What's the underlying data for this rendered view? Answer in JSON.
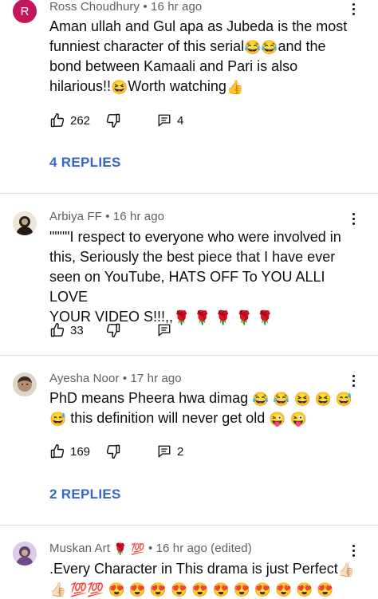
{
  "comments": [
    {
      "author": "Ross Choudhury",
      "time": "16 hr ago",
      "avatar_letter": "R",
      "text_lines": [
        "Aman ullah and Gul apa as Jubeda is the most",
        "funniest character of this serial",
        "and the",
        "bond between Kamaali and Pari is also",
        "hilarious!!",
        "Worth watching"
      ],
      "likes": "262",
      "reply_count": "4",
      "replies_label": "4 REPLIES"
    },
    {
      "author": "Arbiya FF",
      "time": "16 hr ago",
      "text_lines": [
        "\"\"\"\"I respect to everyone who were involved in",
        "this, Seriously the best piece that I have ever",
        "seen on YouTube, HATS OFF To YOU ALLI LOVE",
        "YOUR VIDEO S!!!,,"
      ],
      "likes": "33"
    },
    {
      "author": "Ayesha Noor",
      "time": "17 hr ago",
      "text_lines": [
        "PhD means Pheera hwa dimag",
        "this definition will never get old"
      ],
      "likes": "169",
      "reply_count": "2",
      "replies_label": "2 REPLIES"
    },
    {
      "author": "Muskan Art",
      "time": "16 hr ago (edited)",
      "text_lines": [
        ".Every Character in This drama is just Perfect"
      ]
    }
  ],
  "separator": "•",
  "emoji": {
    "laugh": "😂",
    "grin": "😆",
    "sweat": "😅",
    "wink_tongue": "😜",
    "thumbs": "👍",
    "thumbs_light": "👍🏻",
    "rose": "🌹",
    "hundred": "💯",
    "heart_eyes": "😍"
  },
  "colors": {
    "link": "#3367c9",
    "meta": "#606060",
    "avatar_r": "#c2185b"
  }
}
